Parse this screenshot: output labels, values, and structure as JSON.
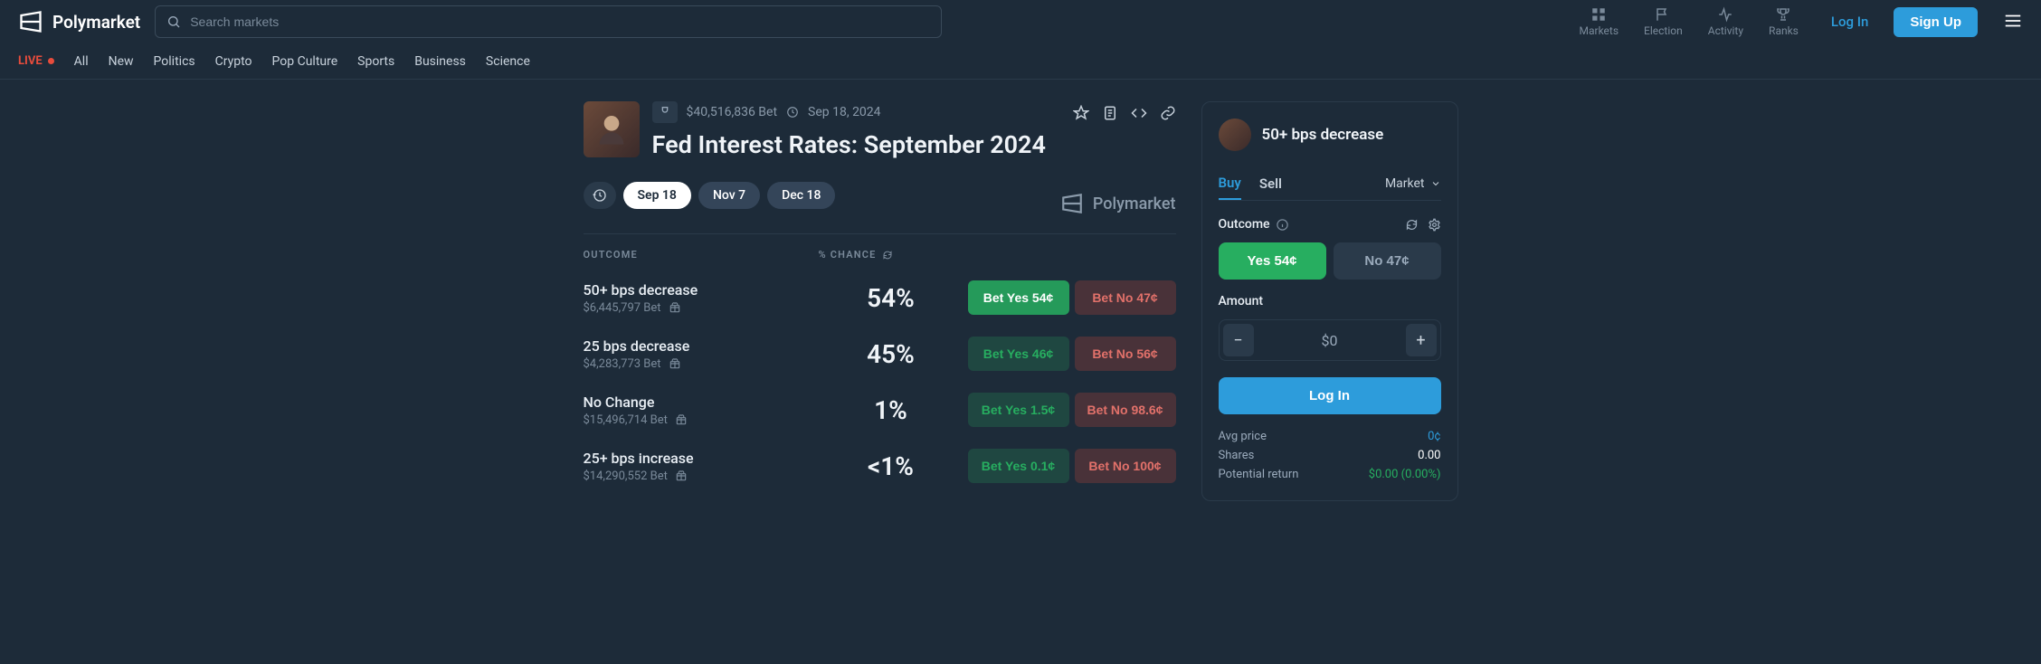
{
  "brand": "Polymarket",
  "search": {
    "placeholder": "Search markets"
  },
  "topnav": [
    {
      "label": "Markets"
    },
    {
      "label": "Election"
    },
    {
      "label": "Activity"
    },
    {
      "label": "Ranks"
    }
  ],
  "auth": {
    "login": "Log In",
    "signup": "Sign Up"
  },
  "categories": {
    "live": "LIVE",
    "items": [
      "All",
      "New",
      "Politics",
      "Crypto",
      "Pop Culture",
      "Sports",
      "Business",
      "Science"
    ]
  },
  "market": {
    "volume": "$40,516,836 Bet",
    "date": "Sep 18, 2024",
    "title": "Fed Interest Rates: September 2024",
    "brand_right": "Polymarket",
    "tabs": [
      "Sep 18",
      "Nov 7",
      "Dec 18"
    ],
    "headers": {
      "outcome": "OUTCOME",
      "chance": "% CHANCE"
    },
    "outcomes": [
      {
        "name": "50+ bps decrease",
        "sub": "$6,445,797 Bet",
        "chance": "54%",
        "yes": "Bet Yes 54¢",
        "no": "Bet No 47¢",
        "yes_strong": true
      },
      {
        "name": "25 bps decrease",
        "sub": "$4,283,773 Bet",
        "chance": "45%",
        "yes": "Bet Yes 46¢",
        "no": "Bet No 56¢",
        "yes_strong": false
      },
      {
        "name": "No Change",
        "sub": "$15,496,714 Bet",
        "chance": "1%",
        "yes": "Bet Yes 1.5¢",
        "no": "Bet No 98.6¢",
        "yes_strong": false
      },
      {
        "name": "25+ bps increase",
        "sub": "$14,290,552 Bet",
        "chance": "<1%",
        "yes": "Bet Yes 0.1¢",
        "no": "Bet No 100¢",
        "yes_strong": false
      }
    ]
  },
  "panel": {
    "title": "50+ bps decrease",
    "tabs": {
      "buy": "Buy",
      "sell": "Sell",
      "market": "Market"
    },
    "outcome_label": "Outcome",
    "yes": "Yes 54¢",
    "no": "No 47¢",
    "amount_label": "Amount",
    "amount_value": "$0",
    "login": "Log In",
    "summary": {
      "avg_label": "Avg price",
      "avg_val": "0¢",
      "shares_label": "Shares",
      "shares_val": "0.00",
      "ret_label": "Potential return",
      "ret_val": "$0.00 (0.00%)"
    }
  }
}
